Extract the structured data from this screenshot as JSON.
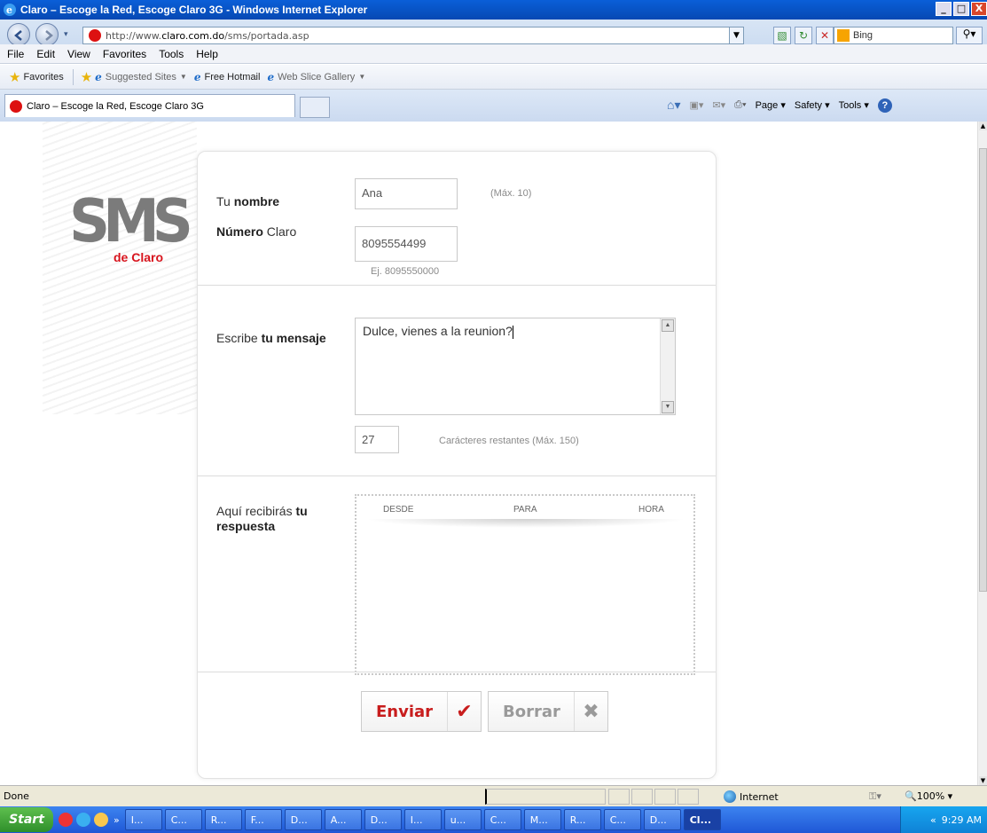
{
  "window": {
    "title": "Claro – Escoge la Red, Escoge Claro 3G - Windows Internet Explorer",
    "controls": [
      "_",
      "□",
      "X"
    ]
  },
  "address_bar": {
    "url_prefix": "http://www.",
    "url_domain": "claro.com.do",
    "url_path": "/sms/portada.asp",
    "search_placeholder": "Bing"
  },
  "menu": [
    "File",
    "Edit",
    "View",
    "Favorites",
    "Tools",
    "Help"
  ],
  "favorites_bar": {
    "favorites_label": "Favorites",
    "items": [
      {
        "label": "Suggested Sites",
        "dropdown": true
      },
      {
        "label": "Free Hotmail",
        "dropdown": false
      },
      {
        "label": "Web Slice Gallery",
        "dropdown": true
      }
    ]
  },
  "tab": {
    "label": "Claro – Escoge la Red, Escoge Claro 3G"
  },
  "command_bar": {
    "page": "Page",
    "safety": "Safety",
    "tools": "Tools"
  },
  "sms": {
    "logo": "SMS",
    "logo_sub": "de Claro",
    "name_label_pre": "Tu ",
    "name_label_bold": "nombre",
    "name_value": "Ana",
    "name_hint": "(Máx. 10)",
    "number_label_bold": "Número",
    "number_label_post": " Claro",
    "number_value": "8095554499",
    "number_hint": "Ej. 8095550000",
    "message_label_pre": "Escribe ",
    "message_label_bold": "tu mensaje",
    "message_value": "Dulce, vienes a la reunion?",
    "chars_remaining": "27",
    "chars_hint": "Carácteres restantes (Máx. 150)",
    "response_label_pre": "Aquí recibirás ",
    "response_label_bold1": "tu",
    "response_label_bold2": "respuesta",
    "response_columns": [
      "DESDE",
      "PARA",
      "HORA"
    ],
    "send_button": "Enviar",
    "clear_button": "Borrar"
  },
  "status_bar": {
    "status": "Done",
    "zone": "Internet",
    "zoom": "100%"
  },
  "taskbar": {
    "start": "Start",
    "chevron": "»",
    "items": [
      "I...",
      "C...",
      "R...",
      "F...",
      "D...",
      "A...",
      "D...",
      "I...",
      "u...",
      "C...",
      "M...",
      "R...",
      "C...",
      "D...",
      "Cl..."
    ],
    "clock": "9:29 AM"
  }
}
